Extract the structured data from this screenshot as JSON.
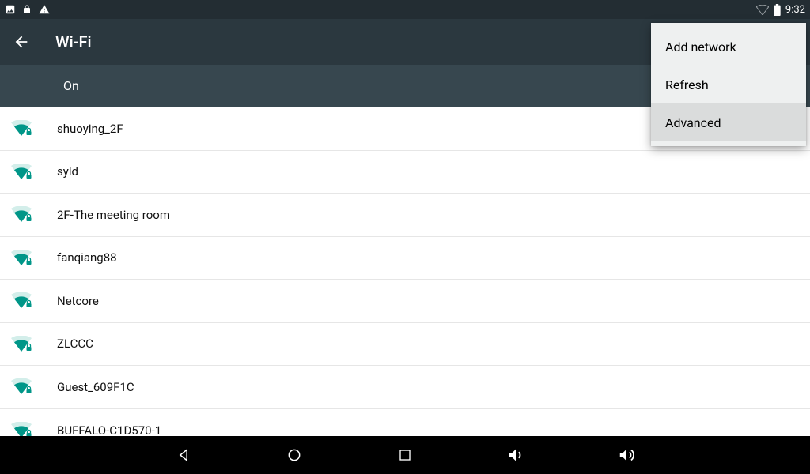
{
  "status": {
    "time": "9:32"
  },
  "appbar": {
    "title": "Wi-Fi"
  },
  "toggle": {
    "state_label": "On"
  },
  "menu": {
    "items": [
      {
        "label": "Add network",
        "highlight": false
      },
      {
        "label": "Refresh",
        "highlight": false
      },
      {
        "label": "Advanced",
        "highlight": true
      }
    ]
  },
  "networks": [
    {
      "ssid": "shuoying_2F",
      "secured": true
    },
    {
      "ssid": "syld",
      "secured": true
    },
    {
      "ssid": "2F-The meeting room",
      "secured": true
    },
    {
      "ssid": "fanqiang88",
      "secured": true
    },
    {
      "ssid": "Netcore",
      "secured": true
    },
    {
      "ssid": "ZLCCC",
      "secured": true
    },
    {
      "ssid": "Guest_609F1C",
      "secured": true
    },
    {
      "ssid": "BUFFALO-C1D570-1",
      "secured": true
    }
  ]
}
